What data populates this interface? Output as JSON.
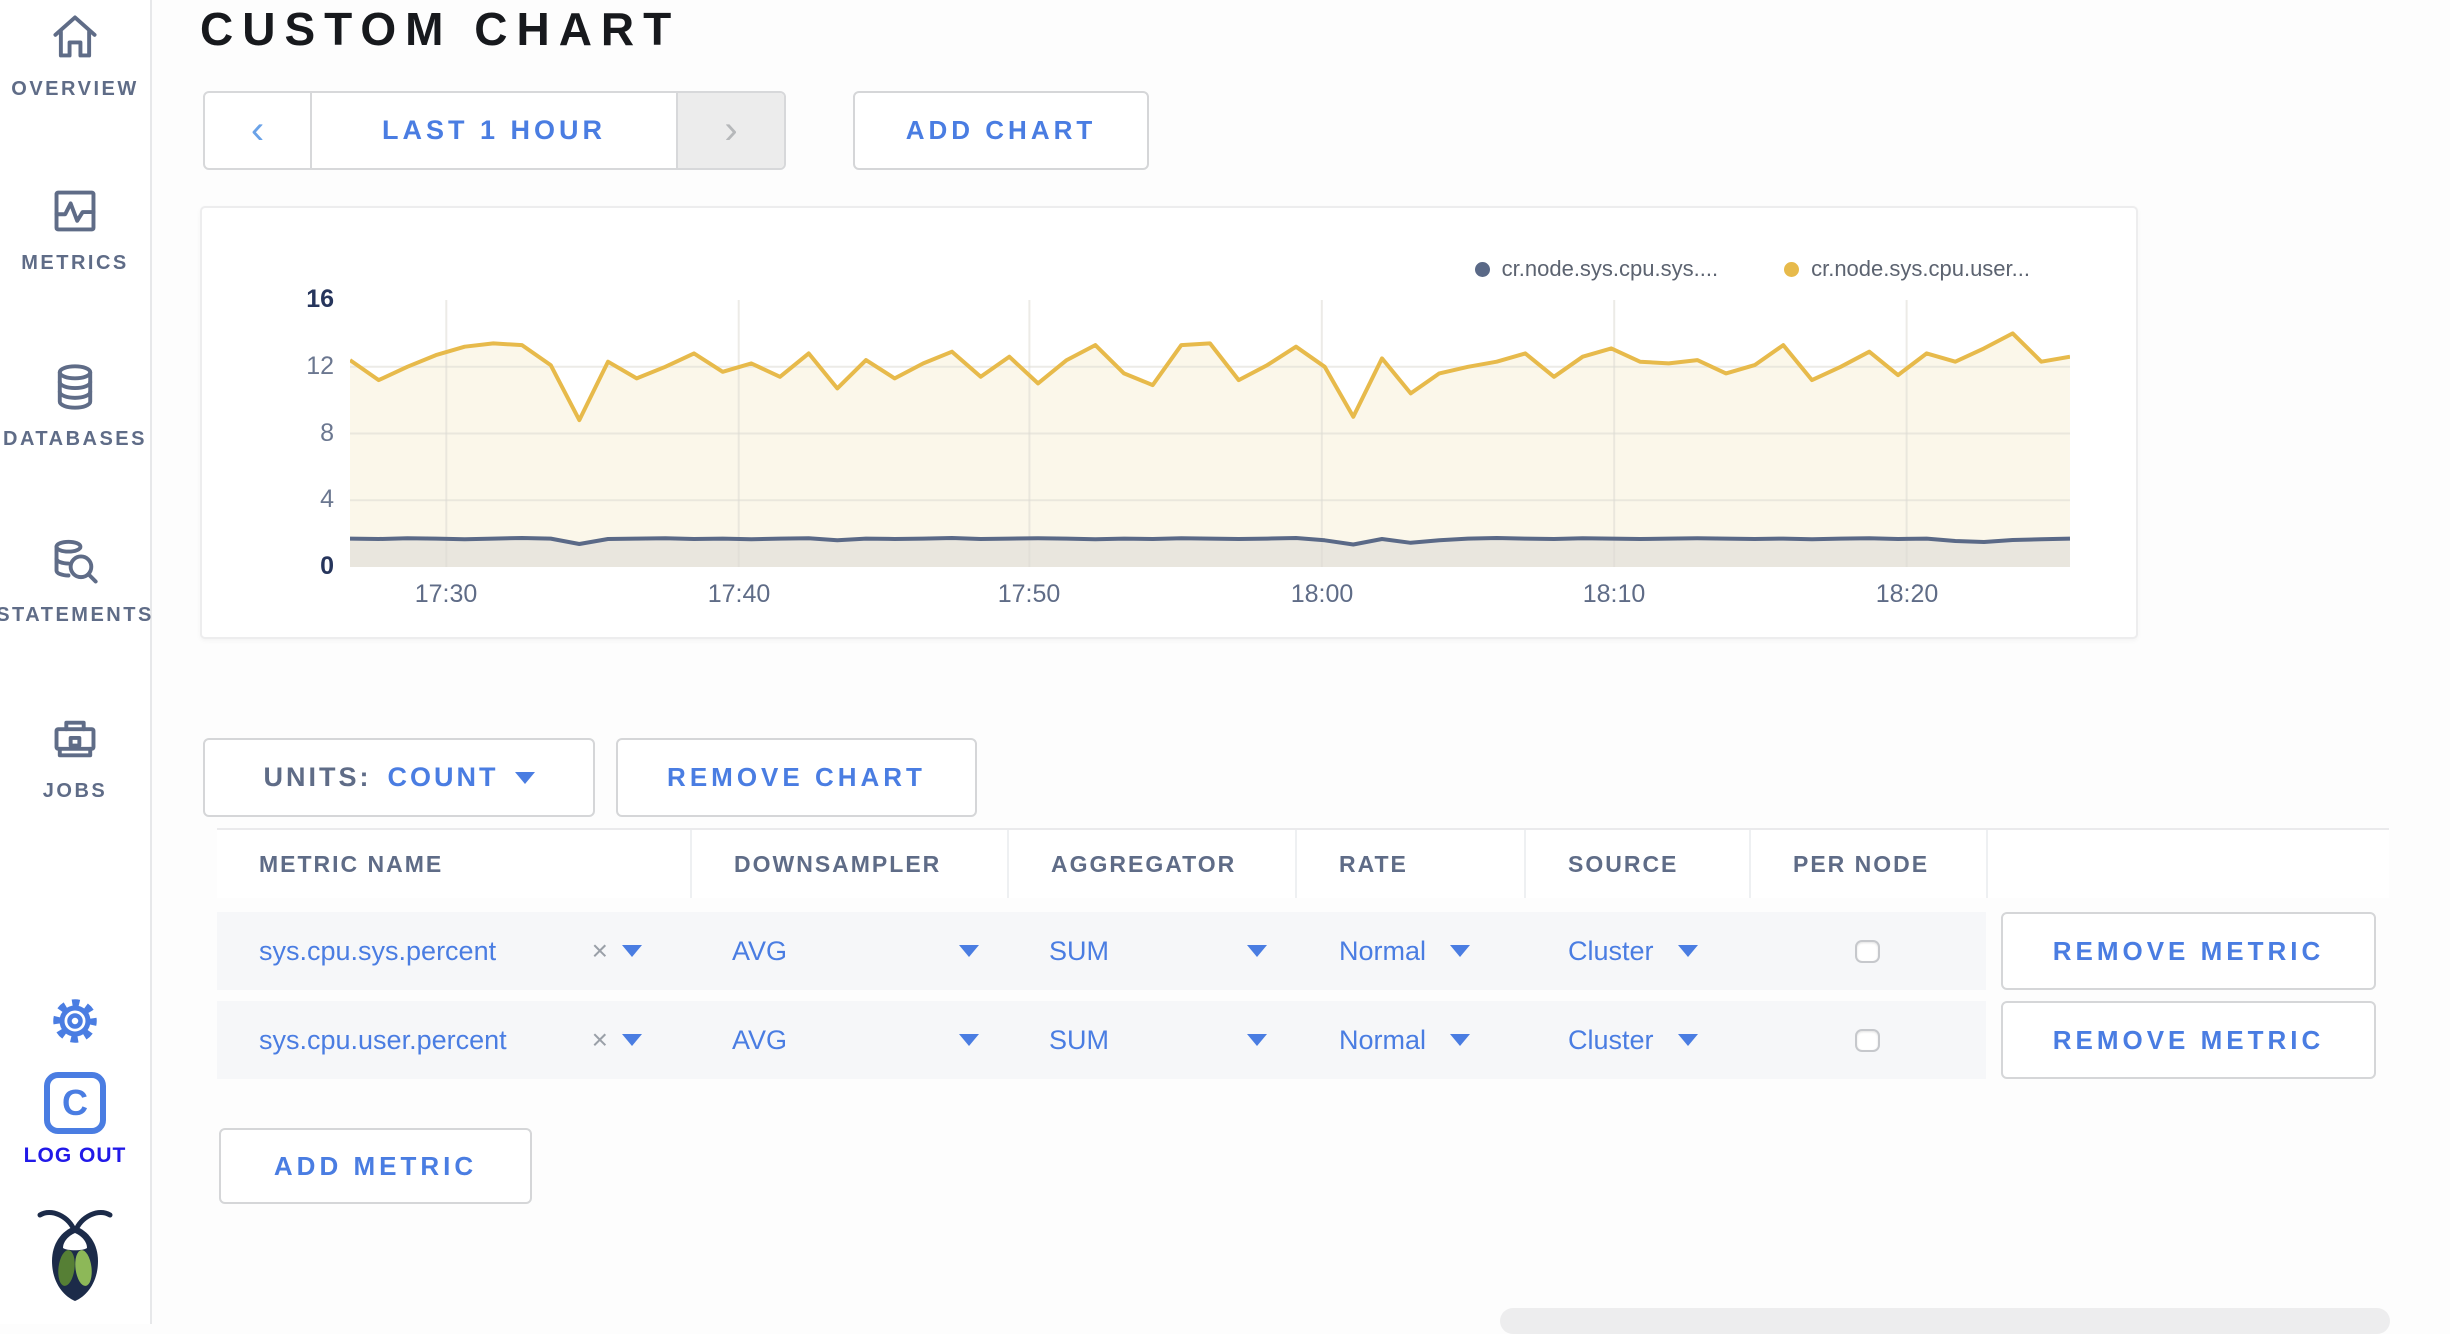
{
  "sidebar": {
    "items": [
      {
        "label": "OVERVIEW"
      },
      {
        "label": "METRICS"
      },
      {
        "label": "DATABASES"
      },
      {
        "label": "STATEMENTS"
      },
      {
        "label": "JOBS"
      }
    ],
    "avatar_letter": "C",
    "logout_label": "LOG OUT"
  },
  "header": {
    "title": "CUSTOM CHART"
  },
  "toolbar": {
    "prev_icon": "‹",
    "time_range_label": "LAST 1 HOUR",
    "next_icon": "›",
    "add_chart_label": "ADD CHART"
  },
  "chart_controls": {
    "units_label": "UNITS:",
    "units_value": "COUNT",
    "remove_chart_label": "REMOVE CHART"
  },
  "table": {
    "headers": [
      "METRIC NAME",
      "DOWNSAMPLER",
      "AGGREGATOR",
      "RATE",
      "SOURCE",
      "PER NODE"
    ],
    "rows": [
      {
        "metric_name": "sys.cpu.sys.percent",
        "clear": "×",
        "downsampler": "AVG",
        "aggregator": "SUM",
        "rate": "Normal",
        "source": "Cluster",
        "per_node_checked": false,
        "remove_label": "REMOVE METRIC"
      },
      {
        "metric_name": "sys.cpu.user.percent",
        "clear": "×",
        "downsampler": "AVG",
        "aggregator": "SUM",
        "rate": "Normal",
        "source": "Cluster",
        "per_node_checked": false,
        "remove_label": "REMOVE METRIC"
      }
    ],
    "add_metric_label": "ADD METRIC"
  },
  "colors": {
    "accent_blue": "#4a7de2",
    "slate": "#5f6c87",
    "logout_blue": "#2119e8",
    "series_sys": "#5a6987",
    "series_user": "#e7ba4b",
    "fill_user": "#fbf7ea",
    "fill_sys": "#e9e6de",
    "grid": "#dddbd4"
  },
  "chart_data": {
    "type": "line",
    "title": "",
    "xlabel": "",
    "ylabel": "",
    "ylim": [
      0,
      16
    ],
    "y_ticks": [
      16,
      12,
      8,
      4,
      0
    ],
    "grid": true,
    "legend_position": "top-right",
    "x_ticks": [
      {
        "label": "17:30",
        "f": 0.056
      },
      {
        "label": "17:40",
        "f": 0.226
      },
      {
        "label": "17:50",
        "f": 0.395
      },
      {
        "label": "18:00",
        "f": 0.565
      },
      {
        "label": "18:10",
        "f": 0.735
      },
      {
        "label": "18:20",
        "f": 0.905
      }
    ],
    "series": [
      {
        "name": "cr.node.sys.cpu.sys....",
        "color": "#5a6987",
        "fill": "#e9e6de",
        "values": [
          1.7,
          1.68,
          1.72,
          1.7,
          1.66,
          1.7,
          1.74,
          1.7,
          1.38,
          1.68,
          1.7,
          1.72,
          1.68,
          1.7,
          1.66,
          1.7,
          1.72,
          1.6,
          1.7,
          1.68,
          1.7,
          1.74,
          1.68,
          1.7,
          1.72,
          1.7,
          1.66,
          1.7,
          1.68,
          1.72,
          1.7,
          1.68,
          1.7,
          1.74,
          1.6,
          1.35,
          1.68,
          1.45,
          1.6,
          1.7,
          1.74,
          1.7,
          1.68,
          1.72,
          1.7,
          1.68,
          1.7,
          1.72,
          1.7,
          1.68,
          1.7,
          1.66,
          1.7,
          1.72,
          1.68,
          1.7,
          1.56,
          1.5,
          1.62,
          1.66,
          1.7
        ]
      },
      {
        "name": "cr.node.sys.cpu.user...",
        "color": "#e7ba4b",
        "fill": "#fbf7ea",
        "values": [
          12.4,
          11.2,
          12.0,
          12.7,
          13.2,
          13.4,
          13.3,
          12.1,
          8.8,
          12.3,
          11.3,
          12.0,
          12.8,
          11.7,
          12.2,
          11.4,
          12.8,
          10.7,
          12.4,
          11.3,
          12.2,
          12.9,
          11.4,
          12.6,
          11.0,
          12.4,
          13.3,
          11.6,
          10.9,
          13.3,
          13.4,
          11.2,
          12.1,
          13.2,
          12.0,
          9.0,
          12.5,
          10.4,
          11.6,
          12.0,
          12.3,
          12.8,
          11.4,
          12.6,
          13.1,
          12.3,
          12.2,
          12.4,
          11.6,
          12.1,
          13.3,
          11.2,
          12.0,
          12.9,
          11.5,
          12.8,
          12.3,
          13.1,
          14.0,
          12.3,
          12.6
        ]
      }
    ]
  }
}
